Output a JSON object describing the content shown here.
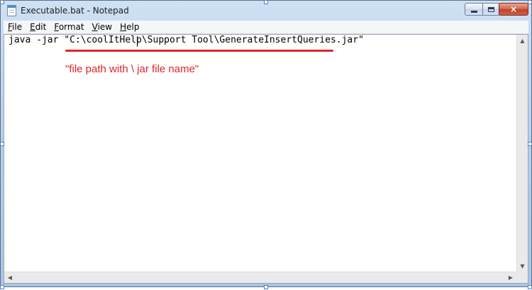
{
  "window": {
    "title": "Executable.bat - Notepad",
    "icon": "notepad-icon",
    "controls": {
      "minimize": "minimize-icon",
      "maximize": "maximize-icon",
      "close": "×"
    }
  },
  "menu": {
    "items": [
      {
        "label": "File",
        "access_key": "F",
        "rest": "ile"
      },
      {
        "label": "Edit",
        "access_key": "E",
        "rest": "dit"
      },
      {
        "label": "Format",
        "access_key": "F",
        "rest": "ormat"
      },
      {
        "label": "View",
        "access_key": "V",
        "rest": "iew"
      },
      {
        "label": "Help",
        "access_key": "H",
        "rest": "elp"
      }
    ]
  },
  "editor": {
    "content": "java -jar \"C:\\coolItHelp\\Support Tool\\GenerateInsertQueries.jar\"",
    "annotation": "\"file path with \\ jar file name\"",
    "annotation_color": "#e0242a"
  },
  "scrollbars": {
    "up": "▲",
    "down": "▼",
    "left": "◀",
    "right": "▶"
  }
}
